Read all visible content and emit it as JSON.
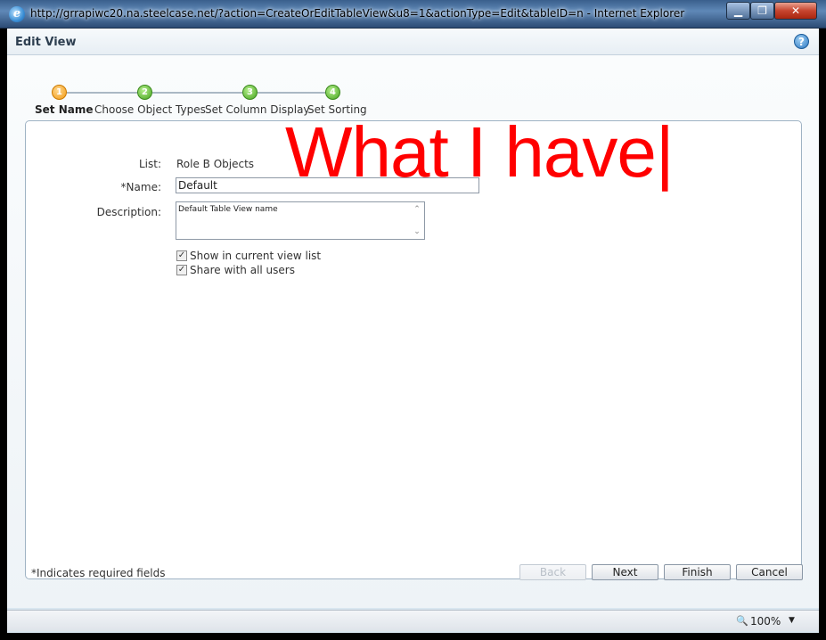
{
  "window": {
    "title": "http://grrapiwc20.na.steelcase.net/?action=CreateOrEditTableView&u8=1&actionType=Edit&tableID=n - Internet Explorer",
    "icon": "ie-icon",
    "min_glyph": "▁",
    "max_glyph": "❐",
    "close_glyph": "✕"
  },
  "dialog": {
    "title": "Edit View",
    "help_glyph": "?"
  },
  "steps": [
    {
      "number": "1",
      "label": "Set Name",
      "active": true
    },
    {
      "number": "2",
      "label": "Choose Object Types",
      "active": false
    },
    {
      "number": "3",
      "label": "Set Column Display",
      "active": false
    },
    {
      "number": "4",
      "label": "Set Sorting",
      "active": false
    }
  ],
  "form": {
    "list_label": "List:",
    "list_value": "Role B Objects",
    "name_label": "*Name:",
    "name_value": "Default",
    "description_label": "Description:",
    "description_value": "Default Table View name",
    "show_in_list_label": "Show in current view list",
    "show_in_list_checked": true,
    "share_label": "Share with all users",
    "share_checked": true
  },
  "annotation": "What I have|",
  "footer": {
    "required_note": "*Indicates required fields",
    "back_label": "Back",
    "next_label": "Next",
    "finish_label": "Finish",
    "cancel_label": "Cancel"
  },
  "statusbar": {
    "zoom": "100%"
  },
  "colors": {
    "annotation": "#ff0000",
    "active_step": "#f29a12",
    "done_step": "#45a41d"
  }
}
